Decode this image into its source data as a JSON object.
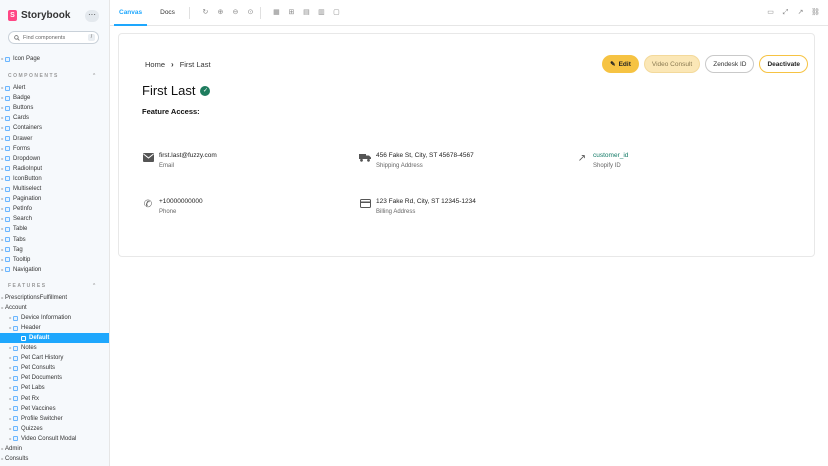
{
  "sidebar": {
    "brand": "Storybook",
    "menu_label": "···",
    "search_placeholder": "Find components",
    "search_shortcut": "/",
    "top_items": [
      {
        "label": "Icon Page"
      }
    ],
    "components_header": "COMPONENTS",
    "components": [
      {
        "label": "Alert"
      },
      {
        "label": "Badge"
      },
      {
        "label": "Buttons"
      },
      {
        "label": "Cards"
      },
      {
        "label": "Containers"
      },
      {
        "label": "Drawer"
      },
      {
        "label": "Forms"
      },
      {
        "label": "Dropdown"
      },
      {
        "label": "RadioInput"
      },
      {
        "label": "IconButton"
      },
      {
        "label": "Multiselect"
      },
      {
        "label": "Pagination"
      },
      {
        "label": "PetInfo"
      },
      {
        "label": "Search"
      },
      {
        "label": "Table"
      },
      {
        "label": "Tabs"
      },
      {
        "label": "Tag"
      },
      {
        "label": "Tooltip"
      },
      {
        "label": "Navigation"
      }
    ],
    "features_header": "FEATURES",
    "features": [
      {
        "label": "PrescriptionsFulfillment",
        "level": 0
      },
      {
        "label": "Account",
        "level": 0
      },
      {
        "label": "Device Information",
        "level": 1
      },
      {
        "label": "Header",
        "level": 1
      },
      {
        "label": "Default",
        "level": 2,
        "selected": true
      },
      {
        "label": "Notes",
        "level": 1
      },
      {
        "label": "Pet Cart History",
        "level": 1
      },
      {
        "label": "Pet Consults",
        "level": 1
      },
      {
        "label": "Pet Documents",
        "level": 1
      },
      {
        "label": "Pet Labs",
        "level": 1
      },
      {
        "label": "Pet Rx",
        "level": 1
      },
      {
        "label": "Pet Vaccines",
        "level": 1
      },
      {
        "label": "Profile Switcher",
        "level": 1
      },
      {
        "label": "Quizzes",
        "level": 1
      },
      {
        "label": "Video Consult Modal",
        "level": 1
      },
      {
        "label": "Admin",
        "level": 0
      },
      {
        "label": "Consults",
        "level": 0
      }
    ]
  },
  "toolbar": {
    "tabs": [
      {
        "label": "Canvas"
      },
      {
        "label": "Docs"
      }
    ]
  },
  "card": {
    "breadcrumb_home": "Home",
    "breadcrumb_current": "First Last",
    "buttons": {
      "edit": "Edit",
      "video": "Video Consult",
      "zendesk": "Zendesk ID",
      "deactivate": "Deactivate"
    },
    "name": "First Last",
    "feature_access": "Feature Access:",
    "email": {
      "value": "first.last@fuzzy.com",
      "label": "Email"
    },
    "phone": {
      "value": "+10000000000",
      "label": "Phone"
    },
    "shipping": {
      "value": "456 Fake St, City, ST 45678-4567",
      "label": "Shipping Address"
    },
    "billing": {
      "value": "123 Fake Rd, City, ST 12345-1234",
      "label": "Billing Address"
    },
    "shopify": {
      "value": "customer_id",
      "label": "Shopify ID"
    }
  },
  "colors": {
    "accent": "#1ea7fd",
    "edit": "#f6c343",
    "verified": "#1e7c5e",
    "link": "#127a66"
  }
}
